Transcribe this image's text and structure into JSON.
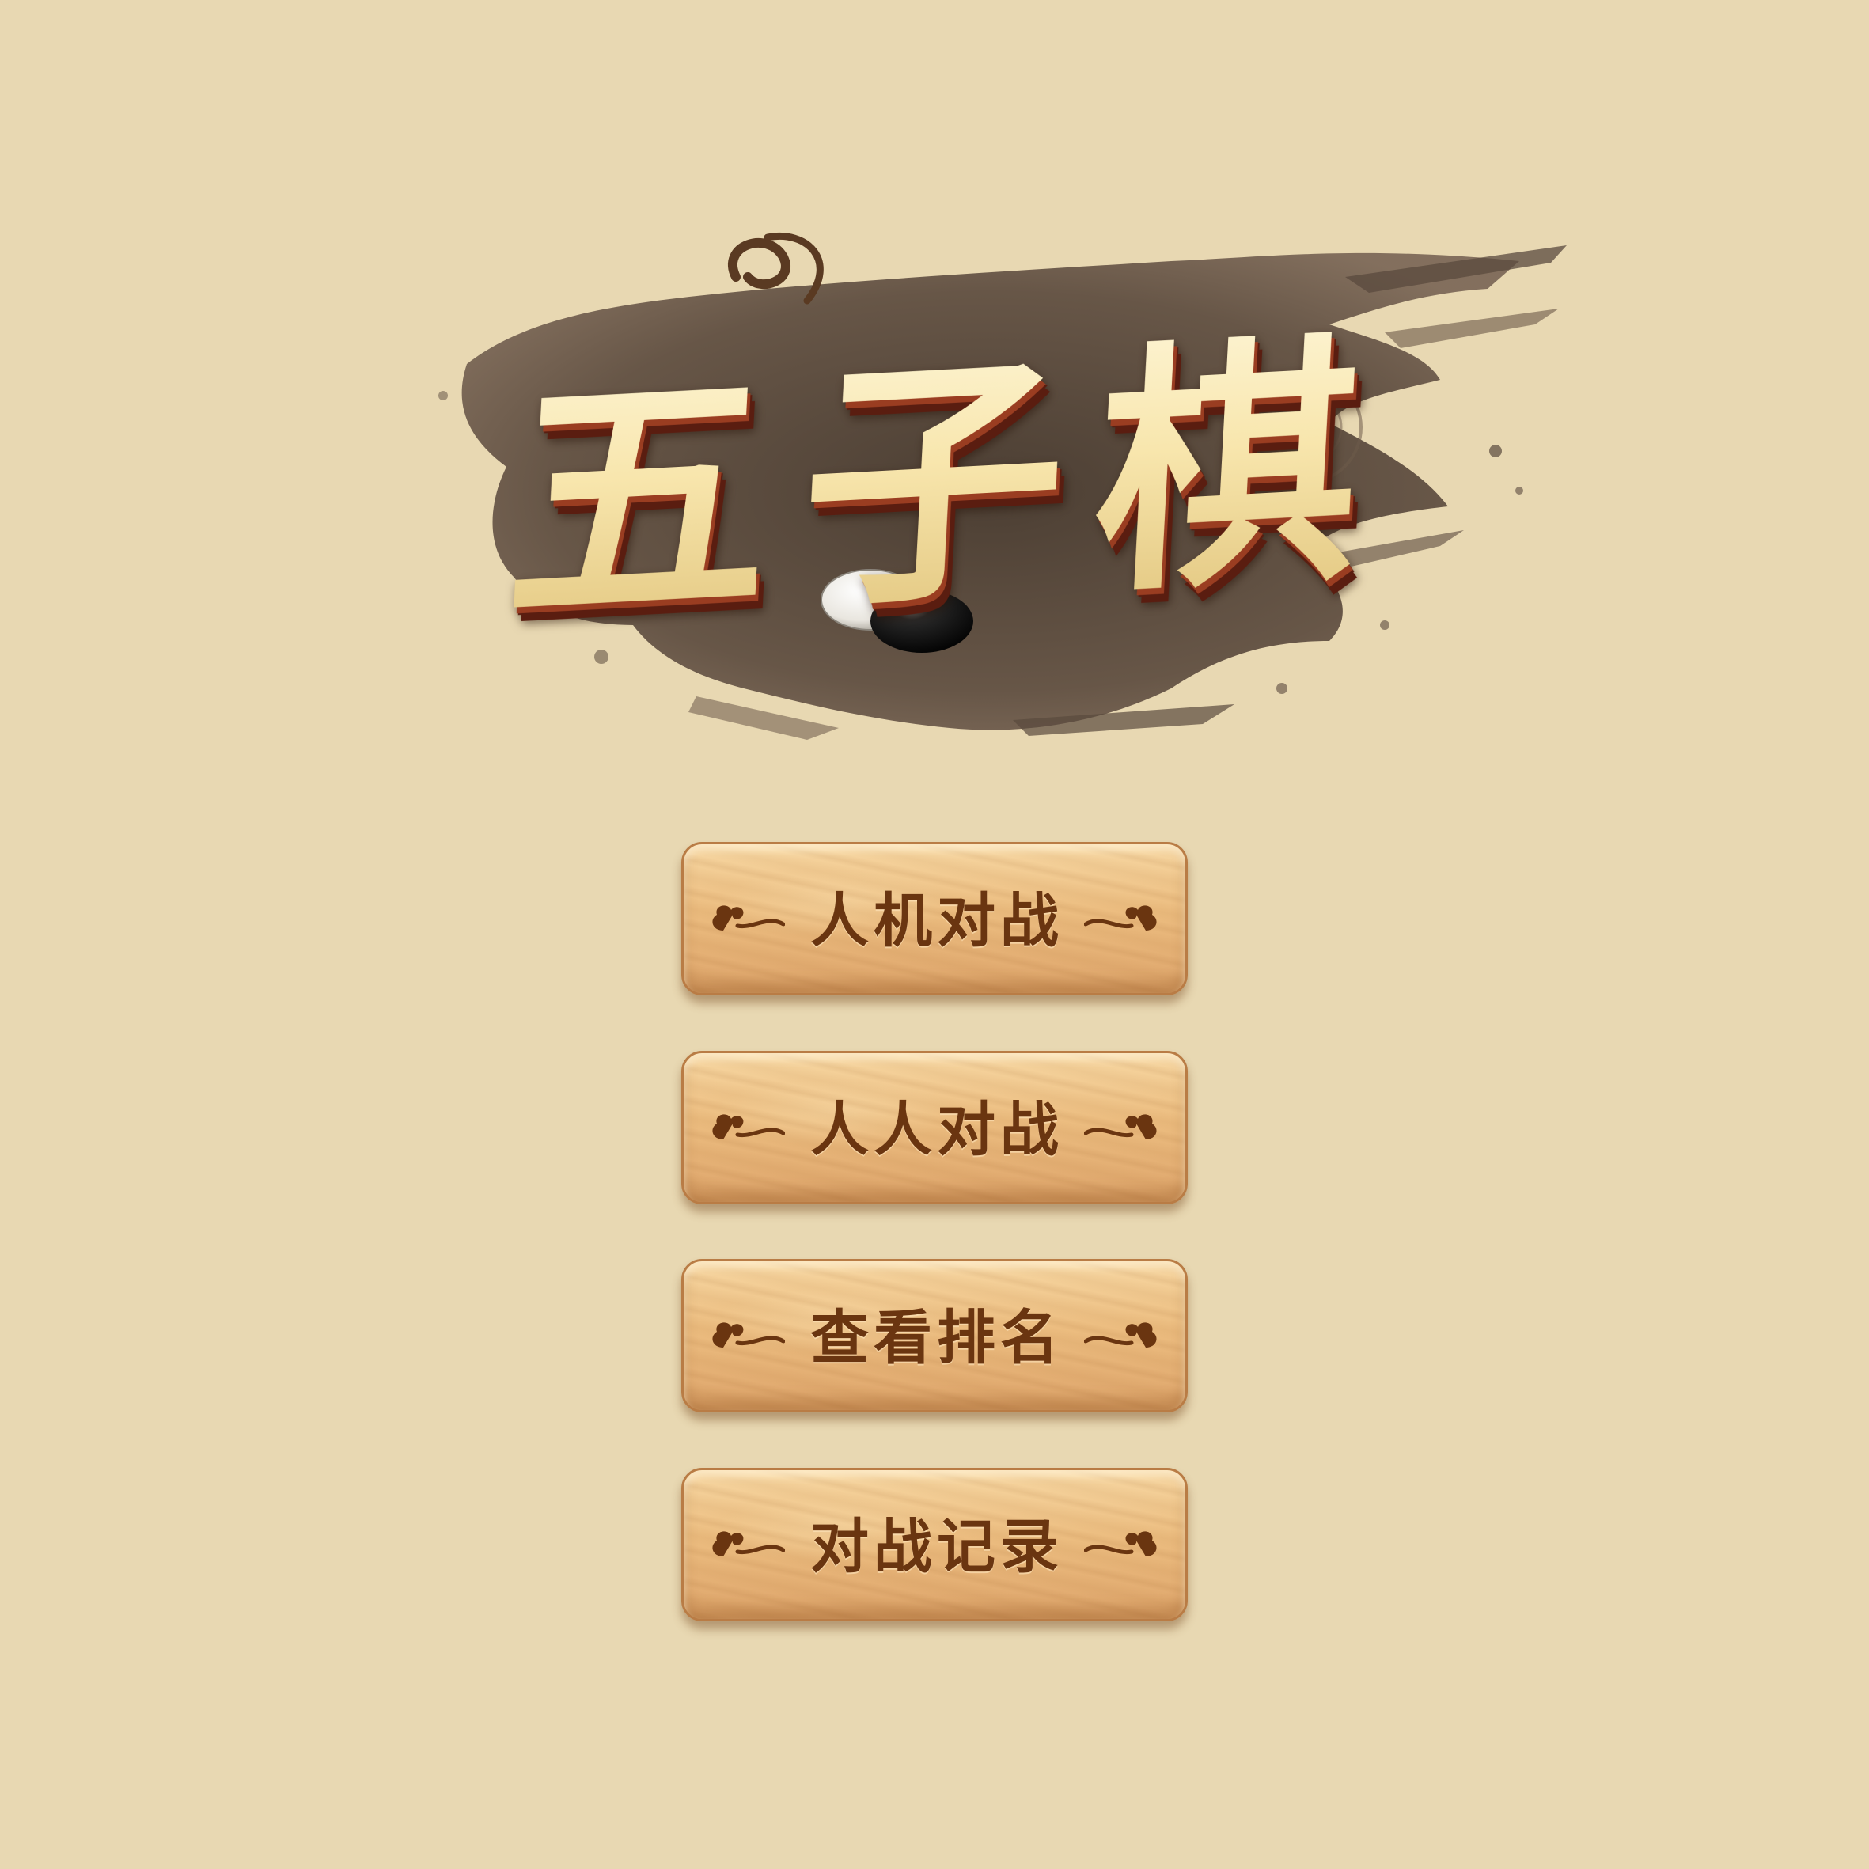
{
  "title": {
    "text": "五子棋",
    "icon": "go-stones-icon"
  },
  "menu": {
    "buttons": [
      {
        "id": "pve",
        "label": "人机对战"
      },
      {
        "id": "pvp",
        "label": "人人对战"
      },
      {
        "id": "ranking",
        "label": "查看排名"
      },
      {
        "id": "history",
        "label": "对战记录"
      }
    ],
    "ornament_icon": "cloud-scroll-icon"
  },
  "colors": {
    "background": "#e8d8b2",
    "button_wood": "#ecbd80",
    "button_text": "#6a3510",
    "title_gold": "#f7e7b0",
    "ink": "#4a3a2e"
  }
}
